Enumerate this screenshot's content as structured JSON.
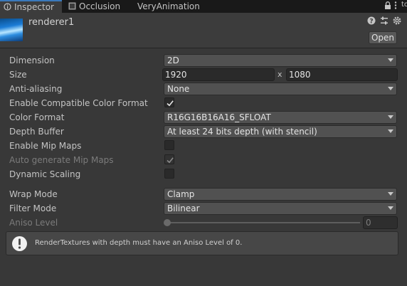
{
  "tabs": [
    {
      "label": "Inspector",
      "icon": "info-icon",
      "active": true
    },
    {
      "label": "Occlusion",
      "icon": "occlusion-icon",
      "active": false
    },
    {
      "label": "VeryAnimation",
      "icon": "",
      "active": false
    }
  ],
  "edge_text": "to",
  "header": {
    "object_name": "renderer1",
    "open_label": "Open"
  },
  "properties": {
    "dimension": {
      "label": "Dimension",
      "value": "2D"
    },
    "size": {
      "label": "Size",
      "width": "1920",
      "x_label": "x",
      "height": "1080"
    },
    "anti_aliasing": {
      "label": "Anti-aliasing",
      "value": "None"
    },
    "compatible_color": {
      "label": "Enable Compatible Color Format",
      "checked": true
    },
    "color_format": {
      "label": "Color Format",
      "value": "R16G16B16A16_SFLOAT"
    },
    "depth_buffer": {
      "label": "Depth Buffer",
      "value": "At least 24 bits depth (with stencil)"
    },
    "mip_maps": {
      "label": "Enable Mip Maps",
      "checked": false
    },
    "auto_mip_maps": {
      "label": "Auto generate Mip Maps",
      "checked": true,
      "disabled": true
    },
    "dynamic_scaling": {
      "label": "Dynamic Scaling",
      "checked": false
    },
    "wrap_mode": {
      "label": "Wrap Mode",
      "value": "Clamp"
    },
    "filter_mode": {
      "label": "Filter Mode",
      "value": "Bilinear"
    },
    "aniso_level": {
      "label": "Aniso Level",
      "value": "0",
      "slider_fraction": 0,
      "disabled": true
    }
  },
  "help": {
    "icon": "exclamation-icon",
    "text": "RenderTextures with depth must have an Aniso Level of 0."
  },
  "colors": {
    "background": "#383838",
    "tab_accent": "#3a79bb",
    "field_bg": "#515151"
  }
}
